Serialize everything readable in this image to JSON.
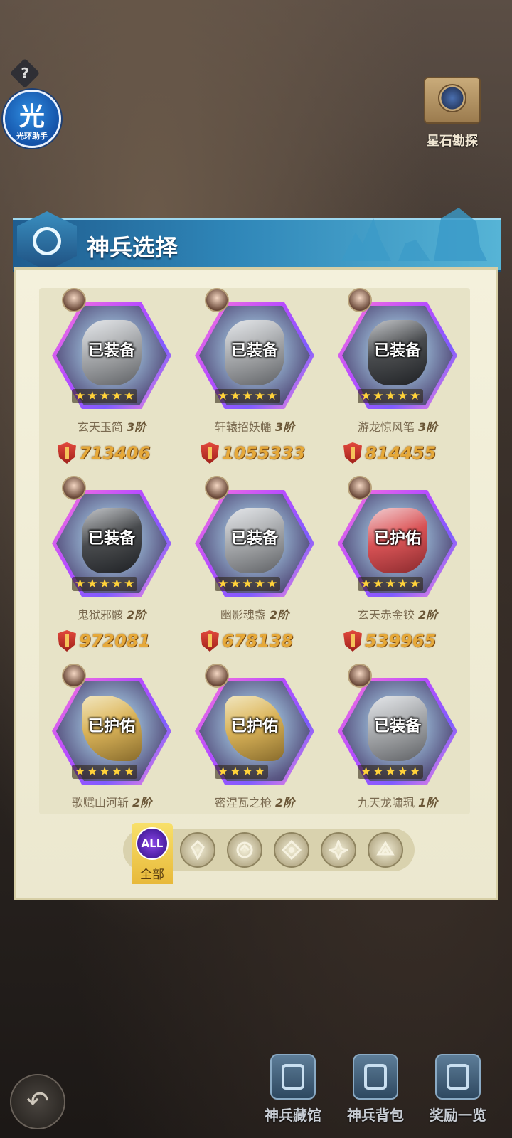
{
  "help": {
    "glyph": "?"
  },
  "helper": {
    "glyph": "光",
    "label": "光环助手"
  },
  "explore": {
    "label": "星石勘探"
  },
  "panel": {
    "title": "神兵选择"
  },
  "cards": [
    {
      "status": "已装备",
      "name": "玄天玉简",
      "rank": "3阶",
      "power": "713406",
      "stars": 5
    },
    {
      "status": "已装备",
      "name": "轩辕招妖幡",
      "rank": "3阶",
      "power": "1055333",
      "stars": 5
    },
    {
      "status": "已装备",
      "name": "游龙惊风笔",
      "rank": "3阶",
      "power": "814455",
      "stars": 5
    },
    {
      "status": "已装备",
      "name": "鬼狱邪骸",
      "rank": "2阶",
      "power": "972081",
      "stars": 5
    },
    {
      "status": "已装备",
      "name": "幽影魂盏",
      "rank": "2阶",
      "power": "678138",
      "stars": 5
    },
    {
      "status": "已护佑",
      "name": "玄天赤金铰",
      "rank": "2阶",
      "power": "539965",
      "stars": 5
    },
    {
      "status": "已护佑",
      "name": "歌赋山河斩",
      "rank": "2阶",
      "power": "",
      "stars": 5
    },
    {
      "status": "已护佑",
      "name": "密涅瓦之枪",
      "rank": "2阶",
      "power": "",
      "stars": 4
    },
    {
      "status": "已装备",
      "name": "九天龙啸珮",
      "rank": "1阶",
      "power": "",
      "stars": 5
    }
  ],
  "filter": {
    "all_icon": "ALL",
    "all_label": "全部",
    "icons": [
      "faction-1-icon",
      "faction-2-icon",
      "faction-3-icon",
      "faction-4-icon",
      "faction-5-icon"
    ]
  },
  "nav": [
    {
      "label": "神兵藏馆"
    },
    {
      "label": "神兵背包"
    },
    {
      "label": "奖励一览"
    }
  ],
  "colors": {
    "accent": "#2f86b8",
    "power": "#e6a93a",
    "frame": "#b84cff"
  }
}
